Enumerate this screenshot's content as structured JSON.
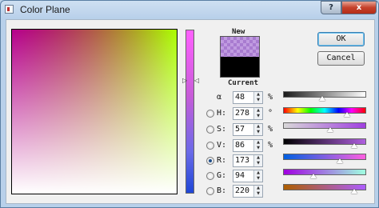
{
  "window": {
    "title": "Color Plane"
  },
  "titlebar": {
    "help": "?",
    "close": "x"
  },
  "swatch": {
    "new_label": "New",
    "current_label": "Current"
  },
  "buttons": {
    "ok": "OK",
    "cancel": "Cancel"
  },
  "rows": [
    {
      "key": "alpha",
      "label": "α",
      "value": "48",
      "unit": "%",
      "radio": false,
      "checked": false,
      "level": 0.47
    },
    {
      "key": "hue",
      "label": "H:",
      "value": "278",
      "unit": "°",
      "radio": true,
      "checked": false,
      "level": 0.77
    },
    {
      "key": "sat",
      "label": "S:",
      "value": "57",
      "unit": "%",
      "radio": true,
      "checked": false,
      "level": 0.57
    },
    {
      "key": "val",
      "label": "V:",
      "value": "86",
      "unit": "%",
      "radio": true,
      "checked": false,
      "level": 0.86
    },
    {
      "key": "red",
      "label": "R:",
      "value": "173",
      "unit": "",
      "radio": true,
      "checked": true,
      "level": 0.68
    },
    {
      "key": "green",
      "label": "G:",
      "value": "94",
      "unit": "",
      "radio": true,
      "checked": false,
      "level": 0.37
    },
    {
      "key": "blue",
      "label": "B:",
      "value": "220",
      "unit": "",
      "radio": true,
      "checked": false,
      "level": 0.86
    }
  ],
  "colors": {
    "new": "#a87bd0",
    "current": "#000000"
  }
}
